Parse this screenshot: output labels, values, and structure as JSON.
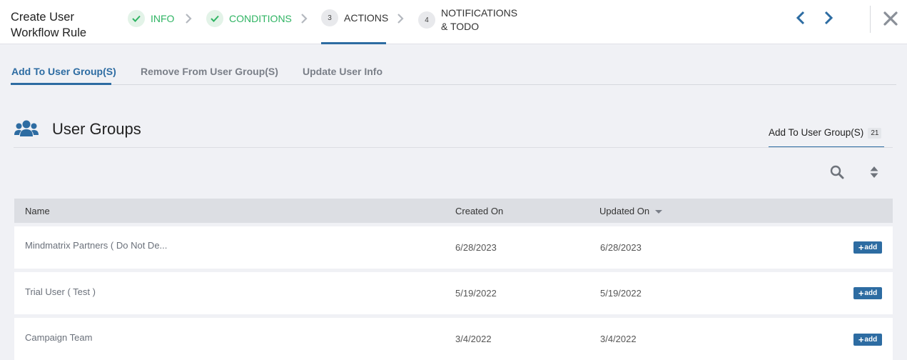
{
  "header": {
    "title": "Create User Workflow Rule",
    "steps": [
      {
        "label": "INFO",
        "status": "done"
      },
      {
        "label": "CONDITIONS",
        "status": "done"
      },
      {
        "number": "3",
        "label": "ACTIONS",
        "status": "current"
      },
      {
        "number": "4",
        "label_line1": "NOTIFICATIONS",
        "label_line2": "& TODO",
        "status": "pending"
      }
    ]
  },
  "subtabs": [
    {
      "label": "Add To User Group(S)",
      "active": true
    },
    {
      "label": "Remove From User Group(S)",
      "active": false
    },
    {
      "label": "Update User Info",
      "active": false
    }
  ],
  "section": {
    "title": "User Groups",
    "right_tab_label": "Add To User Group(S)",
    "right_tab_count": "21"
  },
  "table": {
    "columns": {
      "name": "Name",
      "created": "Created On",
      "updated": "Updated On"
    },
    "add_label": "add",
    "rows": [
      {
        "name": "Mindmatrix Partners ( Do Not De...",
        "created": "6/28/2023",
        "updated": "6/28/2023"
      },
      {
        "name": "Trial User ( Test )",
        "created": "5/19/2022",
        "updated": "5/19/2022"
      },
      {
        "name": "Campaign Team",
        "created": "3/4/2022",
        "updated": "3/4/2022"
      }
    ]
  },
  "colors": {
    "accent": "#2d6ca2",
    "done_green": "#2fb463",
    "background": "#f0f1f5"
  },
  "icons": [
    "check-icon",
    "chevron-right-icon",
    "chevron-left-icon",
    "close-icon",
    "users-icon",
    "search-icon",
    "sort-icon",
    "sort-caret-icon",
    "plus-icon"
  ]
}
